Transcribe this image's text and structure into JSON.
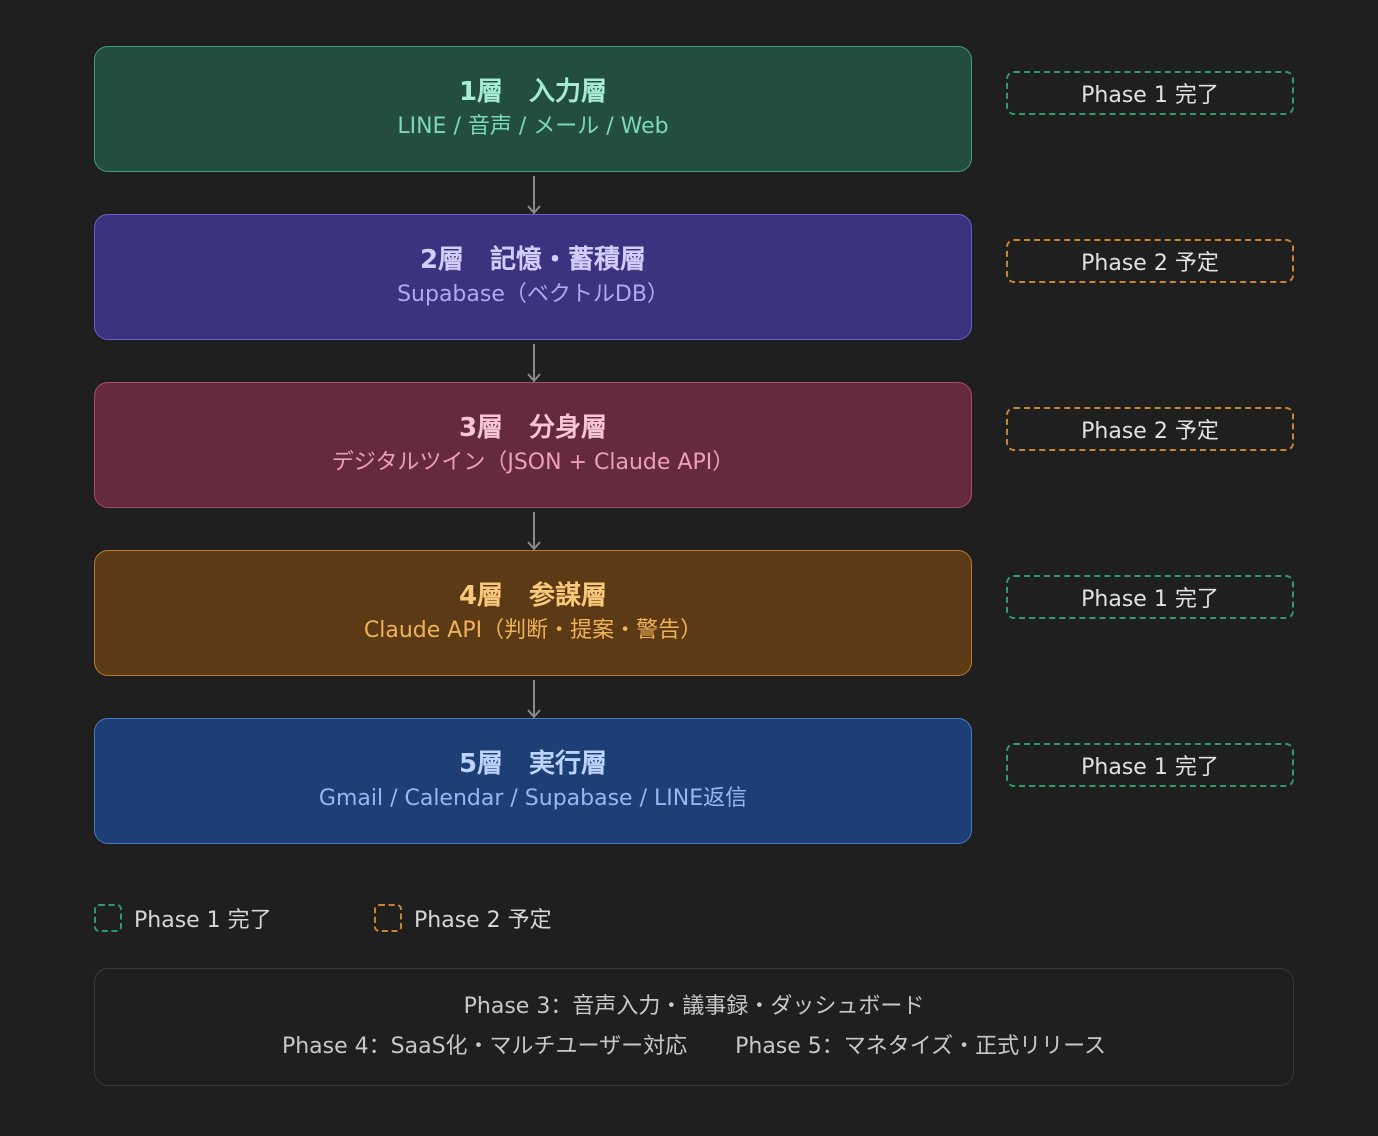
{
  "layers": [
    {
      "title": "1層　入力層",
      "subtitle": "LINE / 音声 / メール / Web",
      "colors": {
        "bg": "#234d3f",
        "border": "#3f9f7a",
        "title": "#a6ecd2",
        "sub": "#7bd9b6"
      }
    },
    {
      "title": "2層　記憶・蓄積層",
      "subtitle": "Supabase（ベクトルDB）",
      "colors": {
        "bg": "#3b3280",
        "border": "#6b60c8",
        "title": "#d2cdfa",
        "sub": "#b1a9f0"
      }
    },
    {
      "title": "3層　分身層",
      "subtitle": "デジタルツイン（JSON + Claude API）",
      "colors": {
        "bg": "#662a3d",
        "border": "#a64d69",
        "title": "#f6c6d5",
        "sub": "#eba0b7"
      }
    },
    {
      "title": "4層　参謀層",
      "subtitle": "Claude API（判断・提案・警告）",
      "colors": {
        "bg": "#5c3a15",
        "border": "#b77b2c",
        "title": "#f8c97a",
        "sub": "#f0b258"
      }
    },
    {
      "title": "5層　実行層",
      "subtitle": "Gmail / Calendar / Supabase / LINE返信",
      "colors": {
        "bg": "#1e3f75",
        "border": "#4b78c2",
        "title": "#bcd4fb",
        "sub": "#94b8f1"
      }
    }
  ],
  "phase_tags": [
    {
      "label": "Phase 1 完了",
      "status": "done"
    },
    {
      "label": "Phase 2 予定",
      "status": "planned"
    },
    {
      "label": "Phase 2 予定",
      "status": "planned"
    },
    {
      "label": "Phase 1 完了",
      "status": "done"
    },
    {
      "label": "Phase 1 完了",
      "status": "done"
    }
  ],
  "legend": {
    "done_label": "Phase 1 完了",
    "planned_label": "Phase 2 予定"
  },
  "roadmap": {
    "phase3": "Phase 3：音声入力・議事録・ダッシュボード",
    "phase4": "Phase 4：SaaS化・マルチユーザー対応",
    "phase5": "Phase 5：マネタイズ・正式リリース"
  },
  "colors": {
    "background": "#1f1f1f",
    "done": "#2f9a6a",
    "planned": "#c98630",
    "arrow": "#8a8a8a"
  }
}
